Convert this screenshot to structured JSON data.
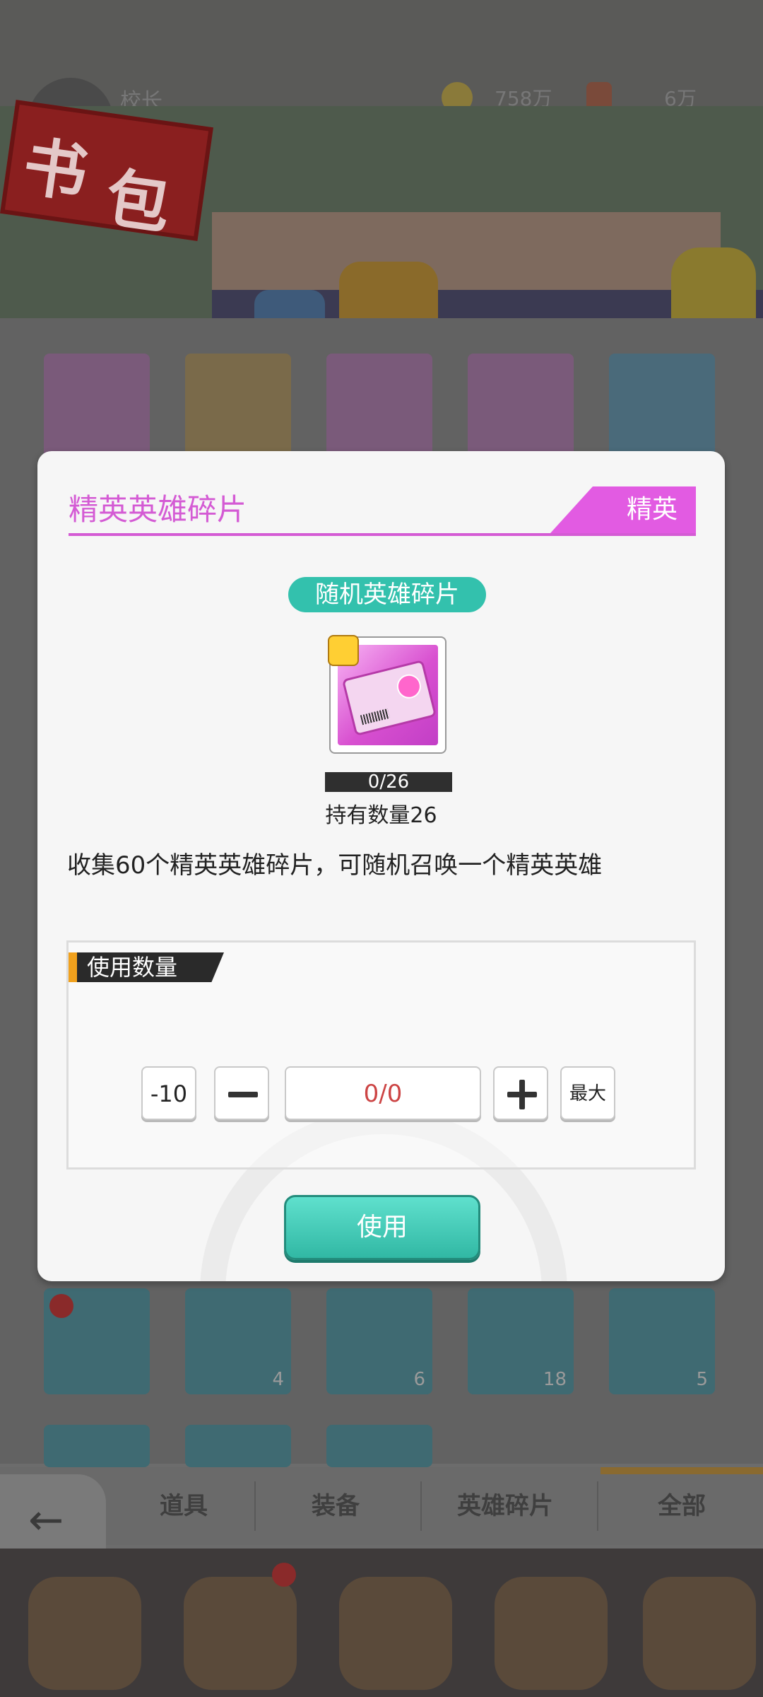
{
  "header": {
    "player_name": "校长",
    "resource_a": "758万",
    "resource_b": "6万"
  },
  "scene": {
    "sign_text": [
      "书",
      "包"
    ]
  },
  "nav": {
    "tabs": [
      "道具",
      "装备",
      "英雄碎片",
      "全部"
    ],
    "back_label": "返回"
  },
  "items_row2": [
    "",
    "4",
    "6",
    "18",
    "5"
  ],
  "dialog": {
    "title": "精英英雄碎片",
    "tag": "精英",
    "category_pill": "随机英雄碎片",
    "item_icon": "hero-ticket-icon",
    "progress": "0/26",
    "owned_label": "持有数量26",
    "description": "收集60个精英英雄碎片，可随机召唤一个精英英雄",
    "qty_section_label": "使用数量",
    "minus10_label": "-10",
    "quantity_value": "0/0",
    "max_label": "最大",
    "use_button": "使用",
    "colors": {
      "accent": "#e25be2",
      "teal": "#33c1ad",
      "qty_text": "#cc4444"
    }
  }
}
